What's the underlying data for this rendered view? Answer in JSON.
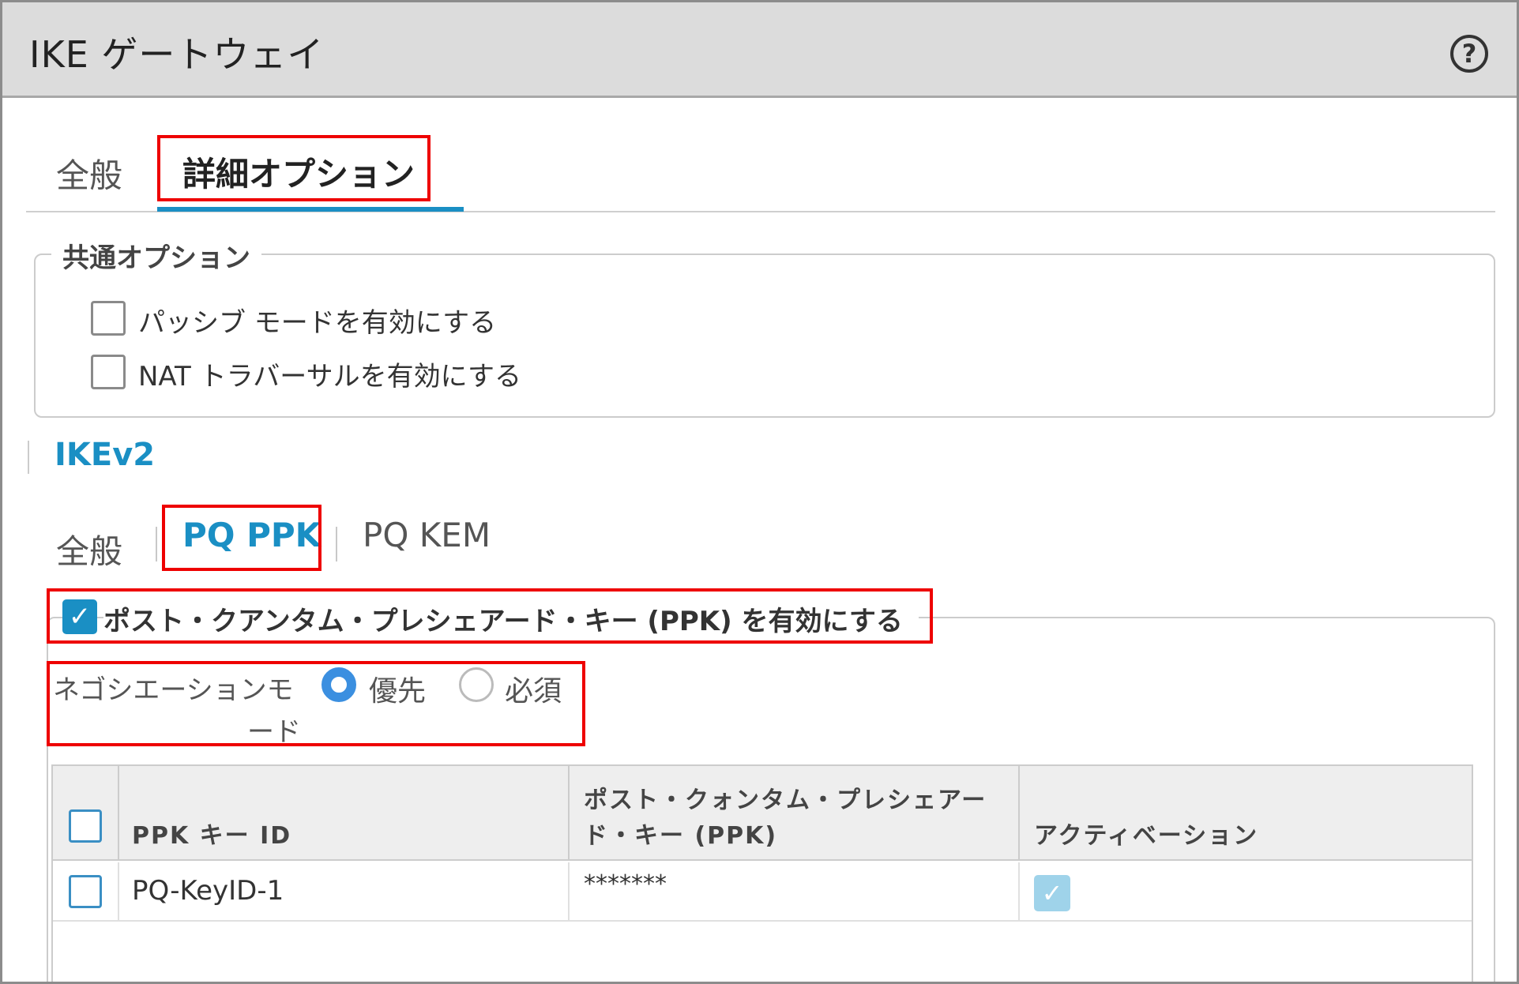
{
  "dialog": {
    "title": "IKE ゲートウェイ"
  },
  "top_tabs": [
    {
      "label": "全般",
      "active": false
    },
    {
      "label": "詳細オプション",
      "active": true
    }
  ],
  "common_options": {
    "legend": "共通オプション",
    "passive_mode": {
      "label": "パッシブ モードを有効にする",
      "checked": false
    },
    "nat_traversal": {
      "label": "NAT トラバーサルを有効にする",
      "checked": false
    }
  },
  "ikev2": {
    "heading": "IKEv2",
    "tabs": [
      {
        "label": "全般",
        "active": false
      },
      {
        "label": "PQ PPK",
        "active": true
      },
      {
        "label": "PQ KEM",
        "active": false
      }
    ],
    "enable_ppk": {
      "label": "ポスト・クアンタム・プレシェアード・キー (PPK) を有効にする",
      "checked": true
    },
    "negotiation_mode": {
      "label_line1": "ネゴシエーションモ",
      "label_line2": "ード",
      "options": [
        {
          "label": "優先",
          "selected": true
        },
        {
          "label": "必須",
          "selected": false
        }
      ]
    },
    "table": {
      "columns": [
        "PPK キー ID",
        "ポスト・クォンタム・プレシェアー",
        "ド・キー (PPK)",
        "アクティベーション"
      ],
      "rows": [
        {
          "key_id": "PQ-KeyID-1",
          "ppk": "*******",
          "activation": true,
          "selected": false
        }
      ]
    }
  },
  "colors": {
    "accent": "#1a8fc4",
    "highlight_box": "#ee0000",
    "radio_on": "#3b8fe0"
  },
  "icons": {
    "help": "help-circle-icon",
    "check": "check-icon"
  }
}
